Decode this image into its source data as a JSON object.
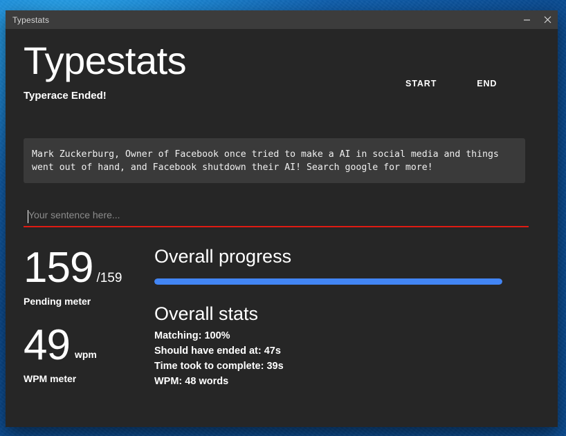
{
  "window": {
    "titlebar_title": "Typestats",
    "minimize_label": "Minimize",
    "close_label": "Close"
  },
  "header": {
    "app_title": "Typestats",
    "status": "Typerace Ended!",
    "nav": [
      {
        "label": "START"
      },
      {
        "label": "END"
      }
    ]
  },
  "sentence": {
    "text": "Mark Zuckerburg, Owner of Facebook once tried to make a AI in social media and things went out of hand, and Facebook shutdown their AI! Search google for more!"
  },
  "input": {
    "placeholder": "Your sentence here...",
    "value": ""
  },
  "meters": {
    "pending": {
      "value": "159",
      "total": "/159",
      "label": "Pending meter"
    },
    "wpm": {
      "value": "49",
      "unit": "wpm",
      "label": "WPM meter"
    }
  },
  "progress": {
    "title": "Overall progress",
    "percent": 100
  },
  "stats": {
    "title": "Overall stats",
    "lines": [
      "Matching: 100%",
      "Should have ended at: 47s",
      "Time took to complete: 39s",
      "WPM: 48 words"
    ]
  },
  "colors": {
    "accent_blue": "#4285f4",
    "input_underline": "#e01b13",
    "panel_bg": "#3a3a3a",
    "window_bg": "#262626",
    "titlebar_bg": "#3c3c3c"
  }
}
